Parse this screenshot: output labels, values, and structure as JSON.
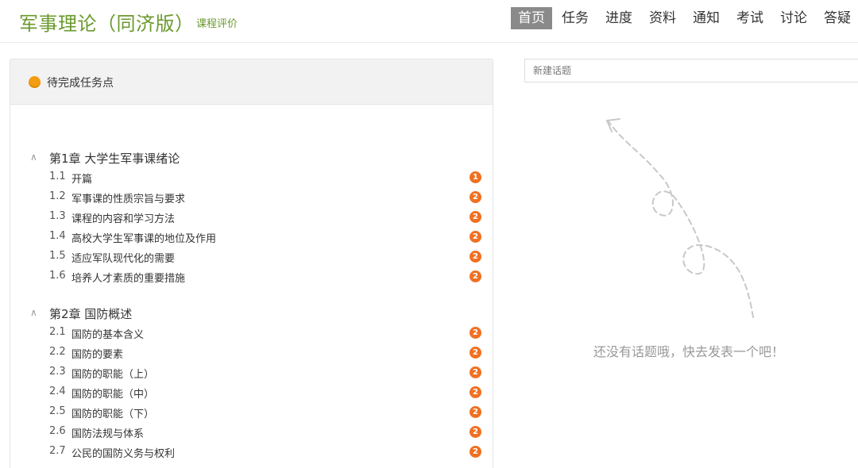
{
  "header": {
    "course_title": "军事理论（同济版）",
    "course_subtitle": "课程评价",
    "nav": [
      {
        "label": "首页",
        "active": true
      },
      {
        "label": "任务",
        "active": false
      },
      {
        "label": "进度",
        "active": false
      },
      {
        "label": "资料",
        "active": false
      },
      {
        "label": "通知",
        "active": false
      },
      {
        "label": "考试",
        "active": false
      },
      {
        "label": "讨论",
        "active": false
      },
      {
        "label": "答疑",
        "active": false
      }
    ]
  },
  "tasks": {
    "title": "待完成任务点",
    "status_color": "#f39c12",
    "badge_color": "#f07022",
    "chapters": [
      {
        "title": "第1章 大学生军事课绪论",
        "lessons": [
          {
            "num": "1.1",
            "title": "开篇",
            "count": "1"
          },
          {
            "num": "1.2",
            "title": "军事课的性质宗旨与要求",
            "count": "2"
          },
          {
            "num": "1.3",
            "title": "课程的内容和学习方法",
            "count": "2"
          },
          {
            "num": "1.4",
            "title": "高校大学生军事课的地位及作用",
            "count": "2"
          },
          {
            "num": "1.5",
            "title": "适应军队现代化的需要",
            "count": "2"
          },
          {
            "num": "1.6",
            "title": "培养人才素质的重要措施",
            "count": "2"
          }
        ]
      },
      {
        "title": "第2章 国防概述",
        "lessons": [
          {
            "num": "2.1",
            "title": "国防的基本含义",
            "count": "2"
          },
          {
            "num": "2.2",
            "title": "国防的要素",
            "count": "2"
          },
          {
            "num": "2.3",
            "title": "国防的职能（上）",
            "count": "2"
          },
          {
            "num": "2.4",
            "title": "国防的职能（中）",
            "count": "2"
          },
          {
            "num": "2.5",
            "title": "国防的职能（下）",
            "count": "2"
          },
          {
            "num": "2.6",
            "title": "国防法规与体系",
            "count": "2"
          },
          {
            "num": "2.7",
            "title": "公民的国防义务与权利",
            "count": "2"
          }
        ]
      }
    ]
  },
  "discussion": {
    "input_placeholder": "新建话题",
    "empty_text": "还没有话题哦，快去发表一个吧！",
    "empty_icon": "dashed-arrow-icon"
  }
}
